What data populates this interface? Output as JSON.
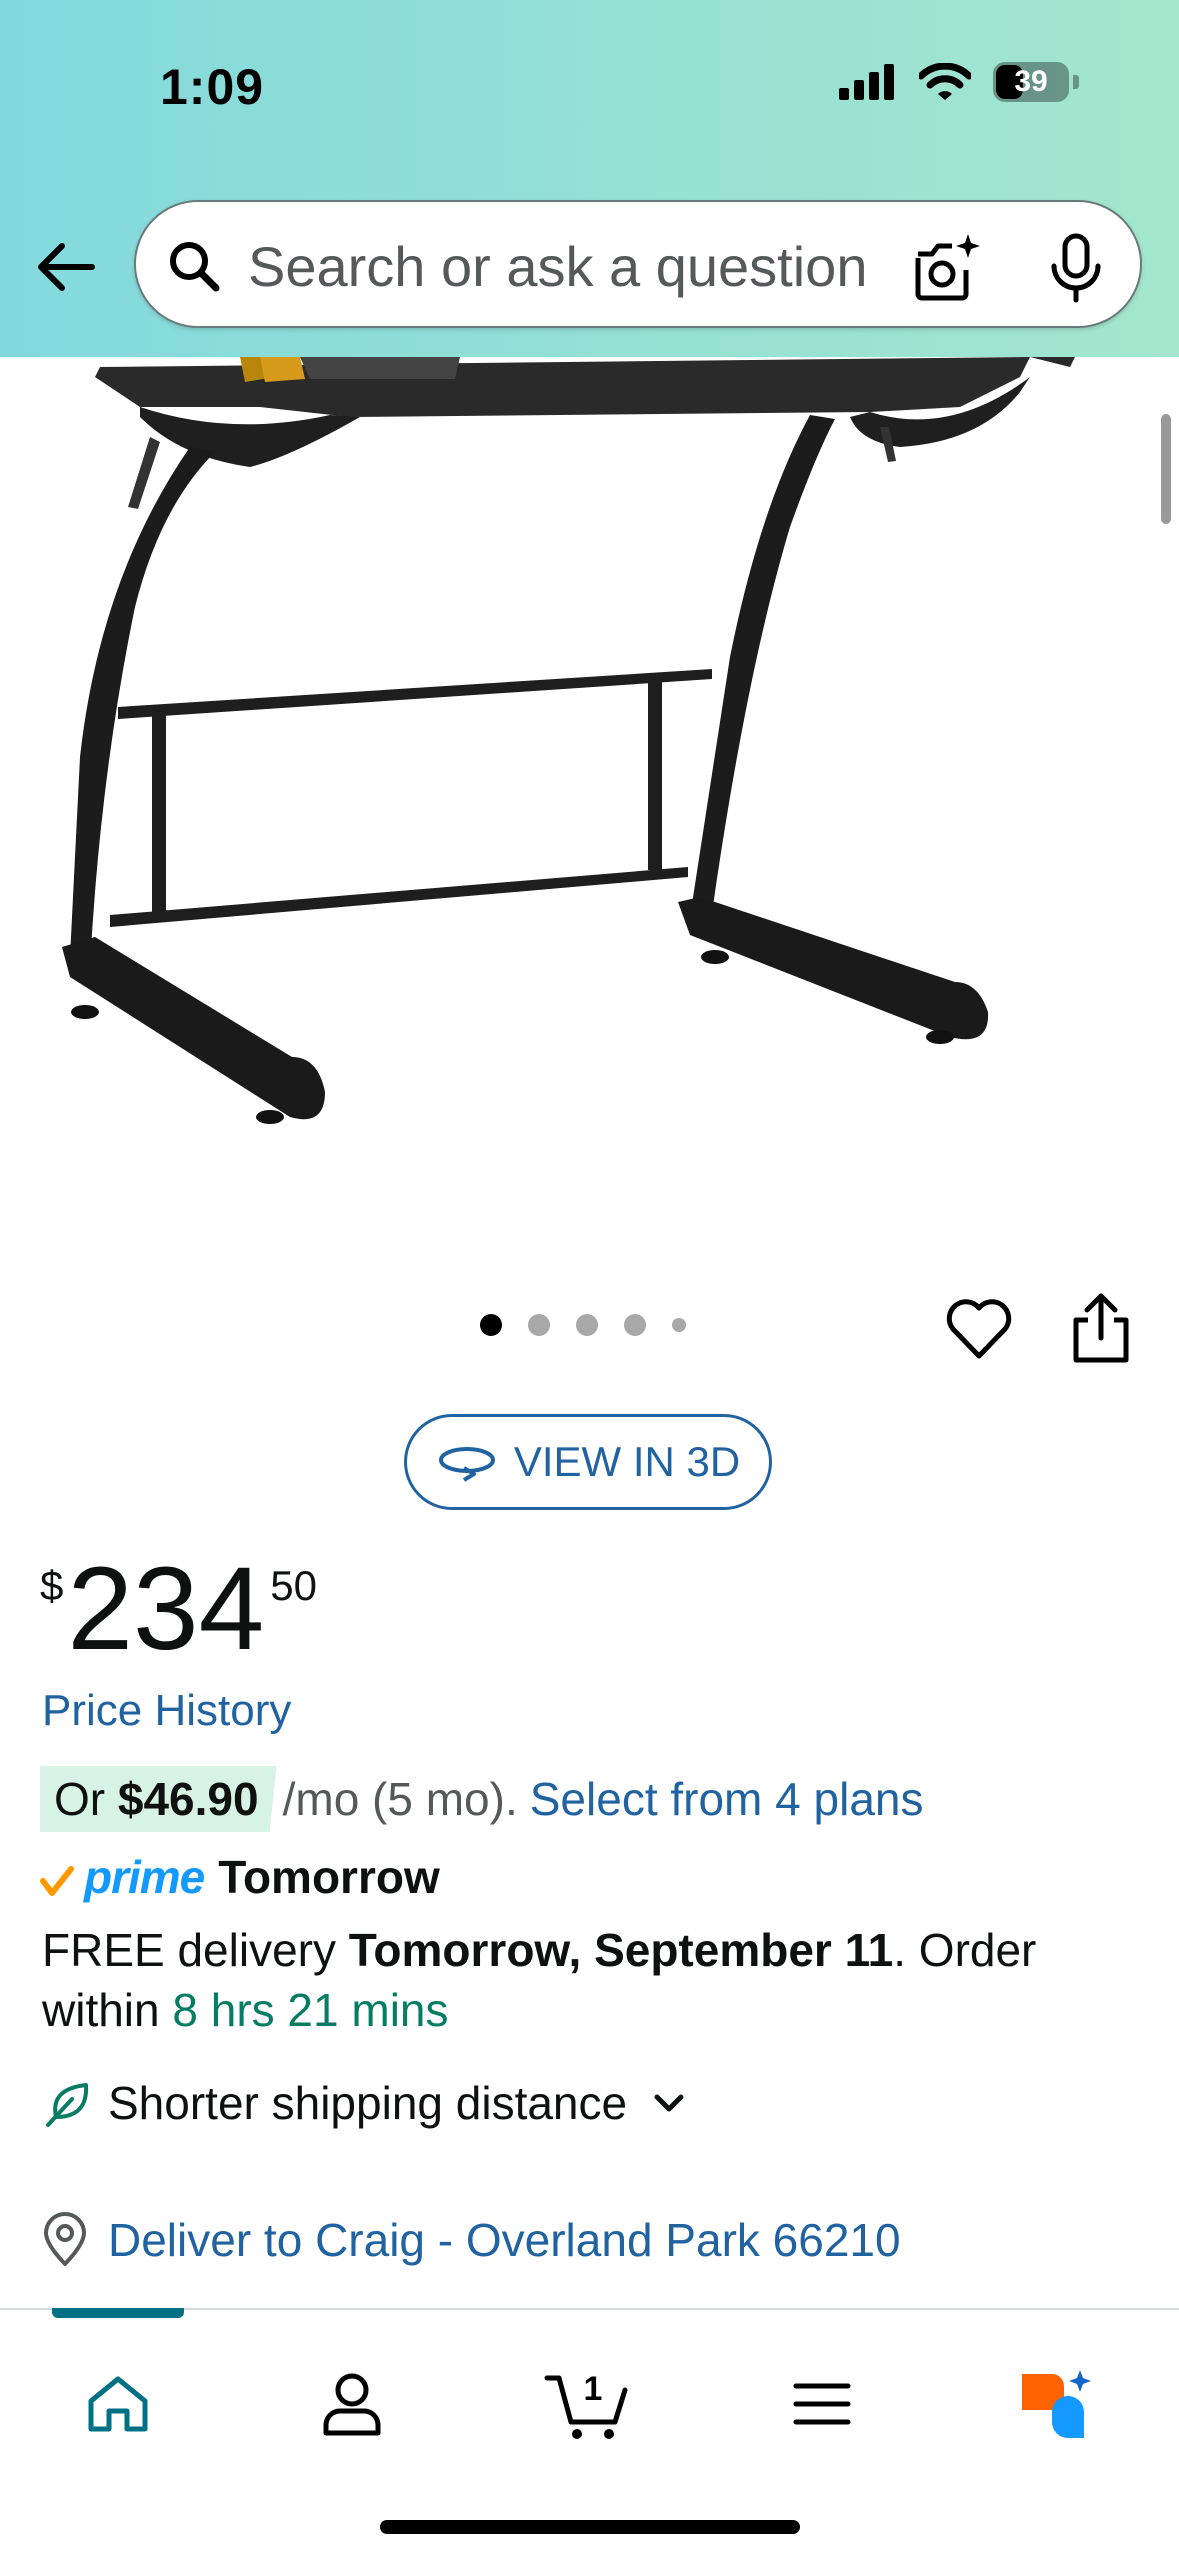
{
  "status_bar": {
    "time": "1:09",
    "battery": "39"
  },
  "search": {
    "placeholder": "Search or ask a question"
  },
  "carousel": {
    "image_count": 5,
    "active_index": 0
  },
  "view3d": {
    "label": "VIEW IN 3D"
  },
  "price": {
    "symbol": "$",
    "whole": "234",
    "fraction": "50"
  },
  "price_history": "Price History",
  "installment": {
    "prefix": "Or ",
    "amount": "$46.90",
    "suffix": "/mo (5 mo).",
    "link": "Select from 4 plans"
  },
  "prime": {
    "logo_text": "prime",
    "day": "Tomorrow"
  },
  "delivery": {
    "prefix": "FREE delivery ",
    "date": "Tomorrow, September 11",
    "middle": ". Order within ",
    "countdown": "8 hrs 21 mins"
  },
  "shipping": {
    "label": "Shorter shipping distance"
  },
  "deliver_to": {
    "label": "Deliver to Craig - Overland Park 66210"
  },
  "bottom_nav": {
    "cart_count": "1"
  },
  "colors": {
    "header_gradient_start": "#83d9dd",
    "header_gradient_end": "#a4e6cd",
    "link": "#2162a1",
    "prime_blue": "#1399ff",
    "prime_check": "#ff9900",
    "green": "#067d62",
    "nav_active": "#007185",
    "rufus_orange": "#ff6200",
    "rufus_blue": "#1399ff"
  },
  "icons": [
    "back-arrow-icon",
    "search-icon",
    "camera-icon",
    "mic-icon",
    "heart-icon",
    "share-icon",
    "view3d-icon",
    "leaf-icon",
    "chevron-down-icon",
    "location-pin-icon",
    "home-icon",
    "account-icon",
    "cart-icon",
    "menu-icon",
    "rufus-icon"
  ]
}
